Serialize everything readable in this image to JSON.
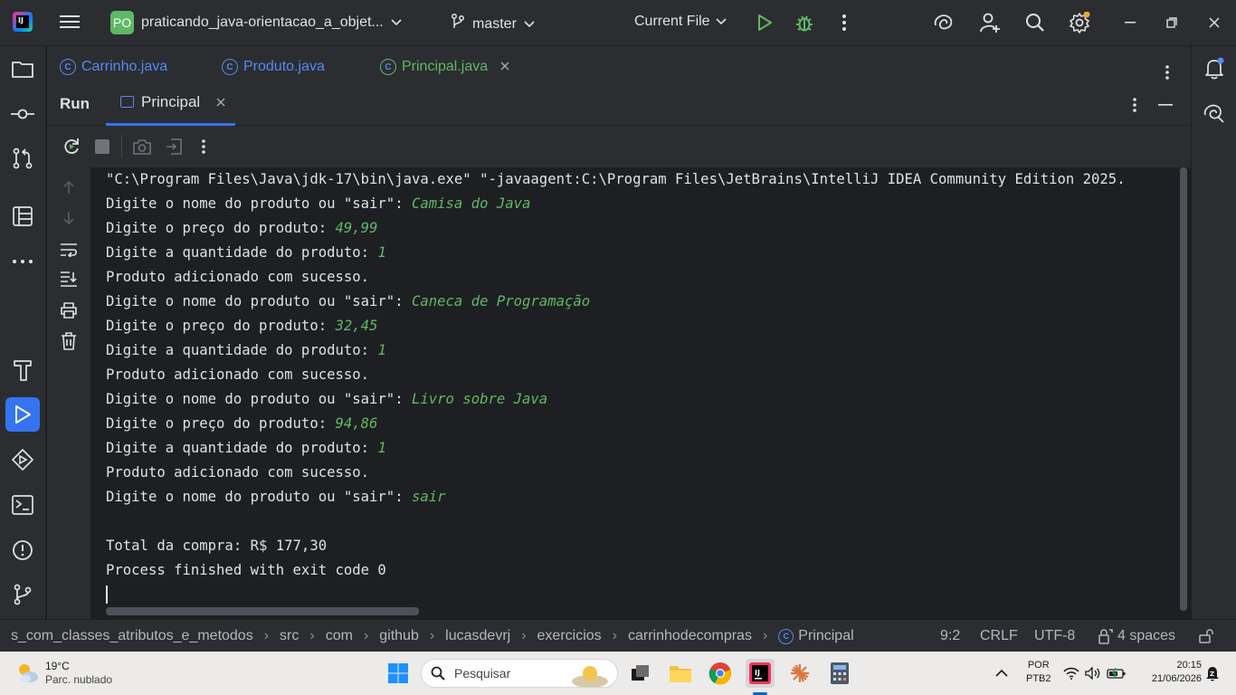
{
  "titlebar": {
    "project_badge": "PO",
    "project_name": "praticando_java-orientacao_a_objet...",
    "branch": "master",
    "run_config": "Current File"
  },
  "editor_tabs": [
    {
      "label": "Carrinho.java",
      "active": false
    },
    {
      "label": "Produto.java",
      "active": false
    },
    {
      "label": "Principal.java",
      "active": true
    }
  ],
  "run_window": {
    "title": "Run",
    "tab_label": "Principal"
  },
  "console": {
    "lines": [
      {
        "text": "\"C:\\Program Files\\Java\\jdk-17\\bin\\java.exe\" \"-javaagent:C:\\Program Files\\JetBrains\\IntelliJ IDEA Community Edition 2025.",
        "input": ""
      },
      {
        "text": "Digite o nome do produto ou \"sair\": ",
        "input": "Camisa do Java"
      },
      {
        "text": "Digite o preço do produto: ",
        "input": "49,99"
      },
      {
        "text": "Digite a quantidade do produto: ",
        "input": "1"
      },
      {
        "text": "Produto adicionado com sucesso.",
        "input": ""
      },
      {
        "text": "Digite o nome do produto ou \"sair\": ",
        "input": "Caneca de Programação"
      },
      {
        "text": "Digite o preço do produto: ",
        "input": "32,45"
      },
      {
        "text": "Digite a quantidade do produto: ",
        "input": "1"
      },
      {
        "text": "Produto adicionado com sucesso.",
        "input": ""
      },
      {
        "text": "Digite o nome do produto ou \"sair\": ",
        "input": "Livro sobre Java"
      },
      {
        "text": "Digite o preço do produto: ",
        "input": "94,86"
      },
      {
        "text": "Digite a quantidade do produto: ",
        "input": "1"
      },
      {
        "text": "Produto adicionado com sucesso.",
        "input": ""
      },
      {
        "text": "Digite o nome do produto ou \"sair\": ",
        "input": "sair"
      },
      {
        "text": "",
        "input": ""
      },
      {
        "text": "Total da compra: R$ 177,30",
        "input": ""
      },
      {
        "text": "Process finished with exit code 0",
        "input": ""
      }
    ]
  },
  "statusbar": {
    "breadcrumbs": [
      "s_com_classes_atributos_e_metodos",
      "src",
      "com",
      "github",
      "lucasdevrj",
      "exercicios",
      "carrinhodecompras",
      "Principal"
    ],
    "position": "9:2",
    "line_ending": "CRLF",
    "encoding": "UTF-8",
    "indent": "4 spaces"
  },
  "taskbar": {
    "temperature": "19°C",
    "weather": "Parc. nublado",
    "search_placeholder": "Pesquisar",
    "language": "POR",
    "keyboard": "PTB2",
    "time": "20:15",
    "date": "21/06/2026"
  },
  "colors": {
    "accent": "#3574f0",
    "input_green": "#5fb865",
    "panel": "#2b2d30",
    "console_bg": "#1e1f22"
  }
}
